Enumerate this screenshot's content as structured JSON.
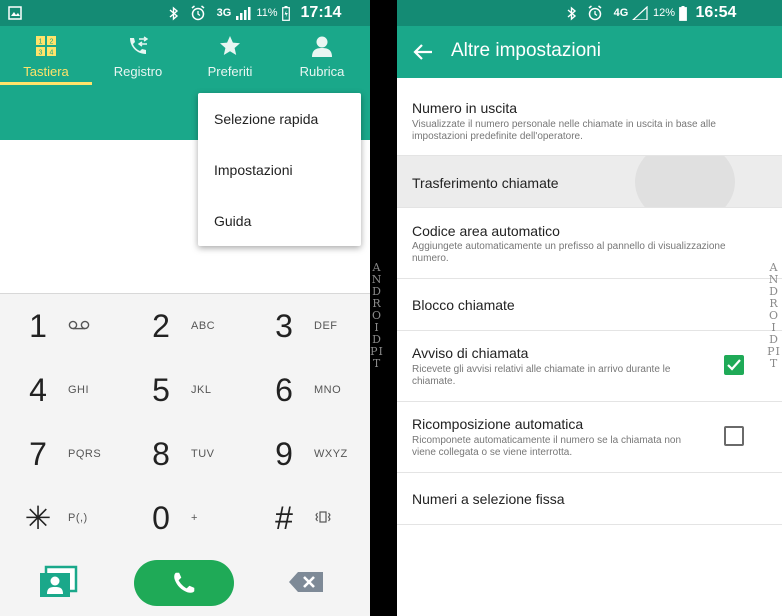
{
  "left_phone": {
    "status_bar": {
      "network": "3G",
      "battery": "11%",
      "time": "17:14"
    },
    "tabs": [
      {
        "label": "Tastiera",
        "icon": "dialpad-icon",
        "active": true
      },
      {
        "label": "Registro",
        "icon": "call-log-icon",
        "active": false
      },
      {
        "label": "Preferiti",
        "icon": "star-icon",
        "active": false
      },
      {
        "label": "Rubrica",
        "icon": "person-icon",
        "active": false
      }
    ],
    "menu": [
      "Selezione rapida",
      "Impostazioni",
      "Guida"
    ],
    "keys": [
      {
        "digit": "1",
        "letters": "voicemail-icon"
      },
      {
        "digit": "2",
        "letters": "ABC"
      },
      {
        "digit": "3",
        "letters": "DEF"
      },
      {
        "digit": "4",
        "letters": "GHI"
      },
      {
        "digit": "5",
        "letters": "JKL"
      },
      {
        "digit": "6",
        "letters": "MNO"
      },
      {
        "digit": "7",
        "letters": "PQRS"
      },
      {
        "digit": "8",
        "letters": "TUV"
      },
      {
        "digit": "9",
        "letters": "WXYZ"
      },
      {
        "digit": "✳",
        "letters": "P(,)"
      },
      {
        "digit": "0",
        "letters": "+"
      },
      {
        "digit": "#",
        "letters": "vibrate-icon"
      }
    ],
    "colors": {
      "accent": "#1aa88a",
      "active_tab": "#ffe36a",
      "call": "#1faa57"
    }
  },
  "right_phone": {
    "status_bar": {
      "network": "4G",
      "battery": "12%",
      "time": "16:54"
    },
    "title": "Altre impostazioni",
    "settings": [
      {
        "title": "Numero in uscita",
        "subtitle": "Visualizzate il numero personale nelle chiamate in uscita in base alle impostazioni predefinite dell'operatore."
      },
      {
        "title": "Trasferimento chiamate",
        "subtitle": ""
      },
      {
        "title": "Codice area automatico",
        "subtitle": "Aggiungete automaticamente un prefisso al pannello di visualizzazione numero."
      },
      {
        "title": "Blocco chiamate",
        "subtitle": ""
      },
      {
        "title": "Avviso di chiamata",
        "subtitle": "Ricevete gli avvisi relativi alle chiamate in arrivo durante le chiamate.",
        "checked": true
      },
      {
        "title": "Ricomposizione automatica",
        "subtitle": "Ricomponete automaticamente il numero se la chiamata non viene collegata o se viene interrotta.",
        "checked": false
      },
      {
        "title": "Numeri a selezione fissa",
        "subtitle": ""
      }
    ]
  },
  "watermark": "ANDROIDPIT"
}
